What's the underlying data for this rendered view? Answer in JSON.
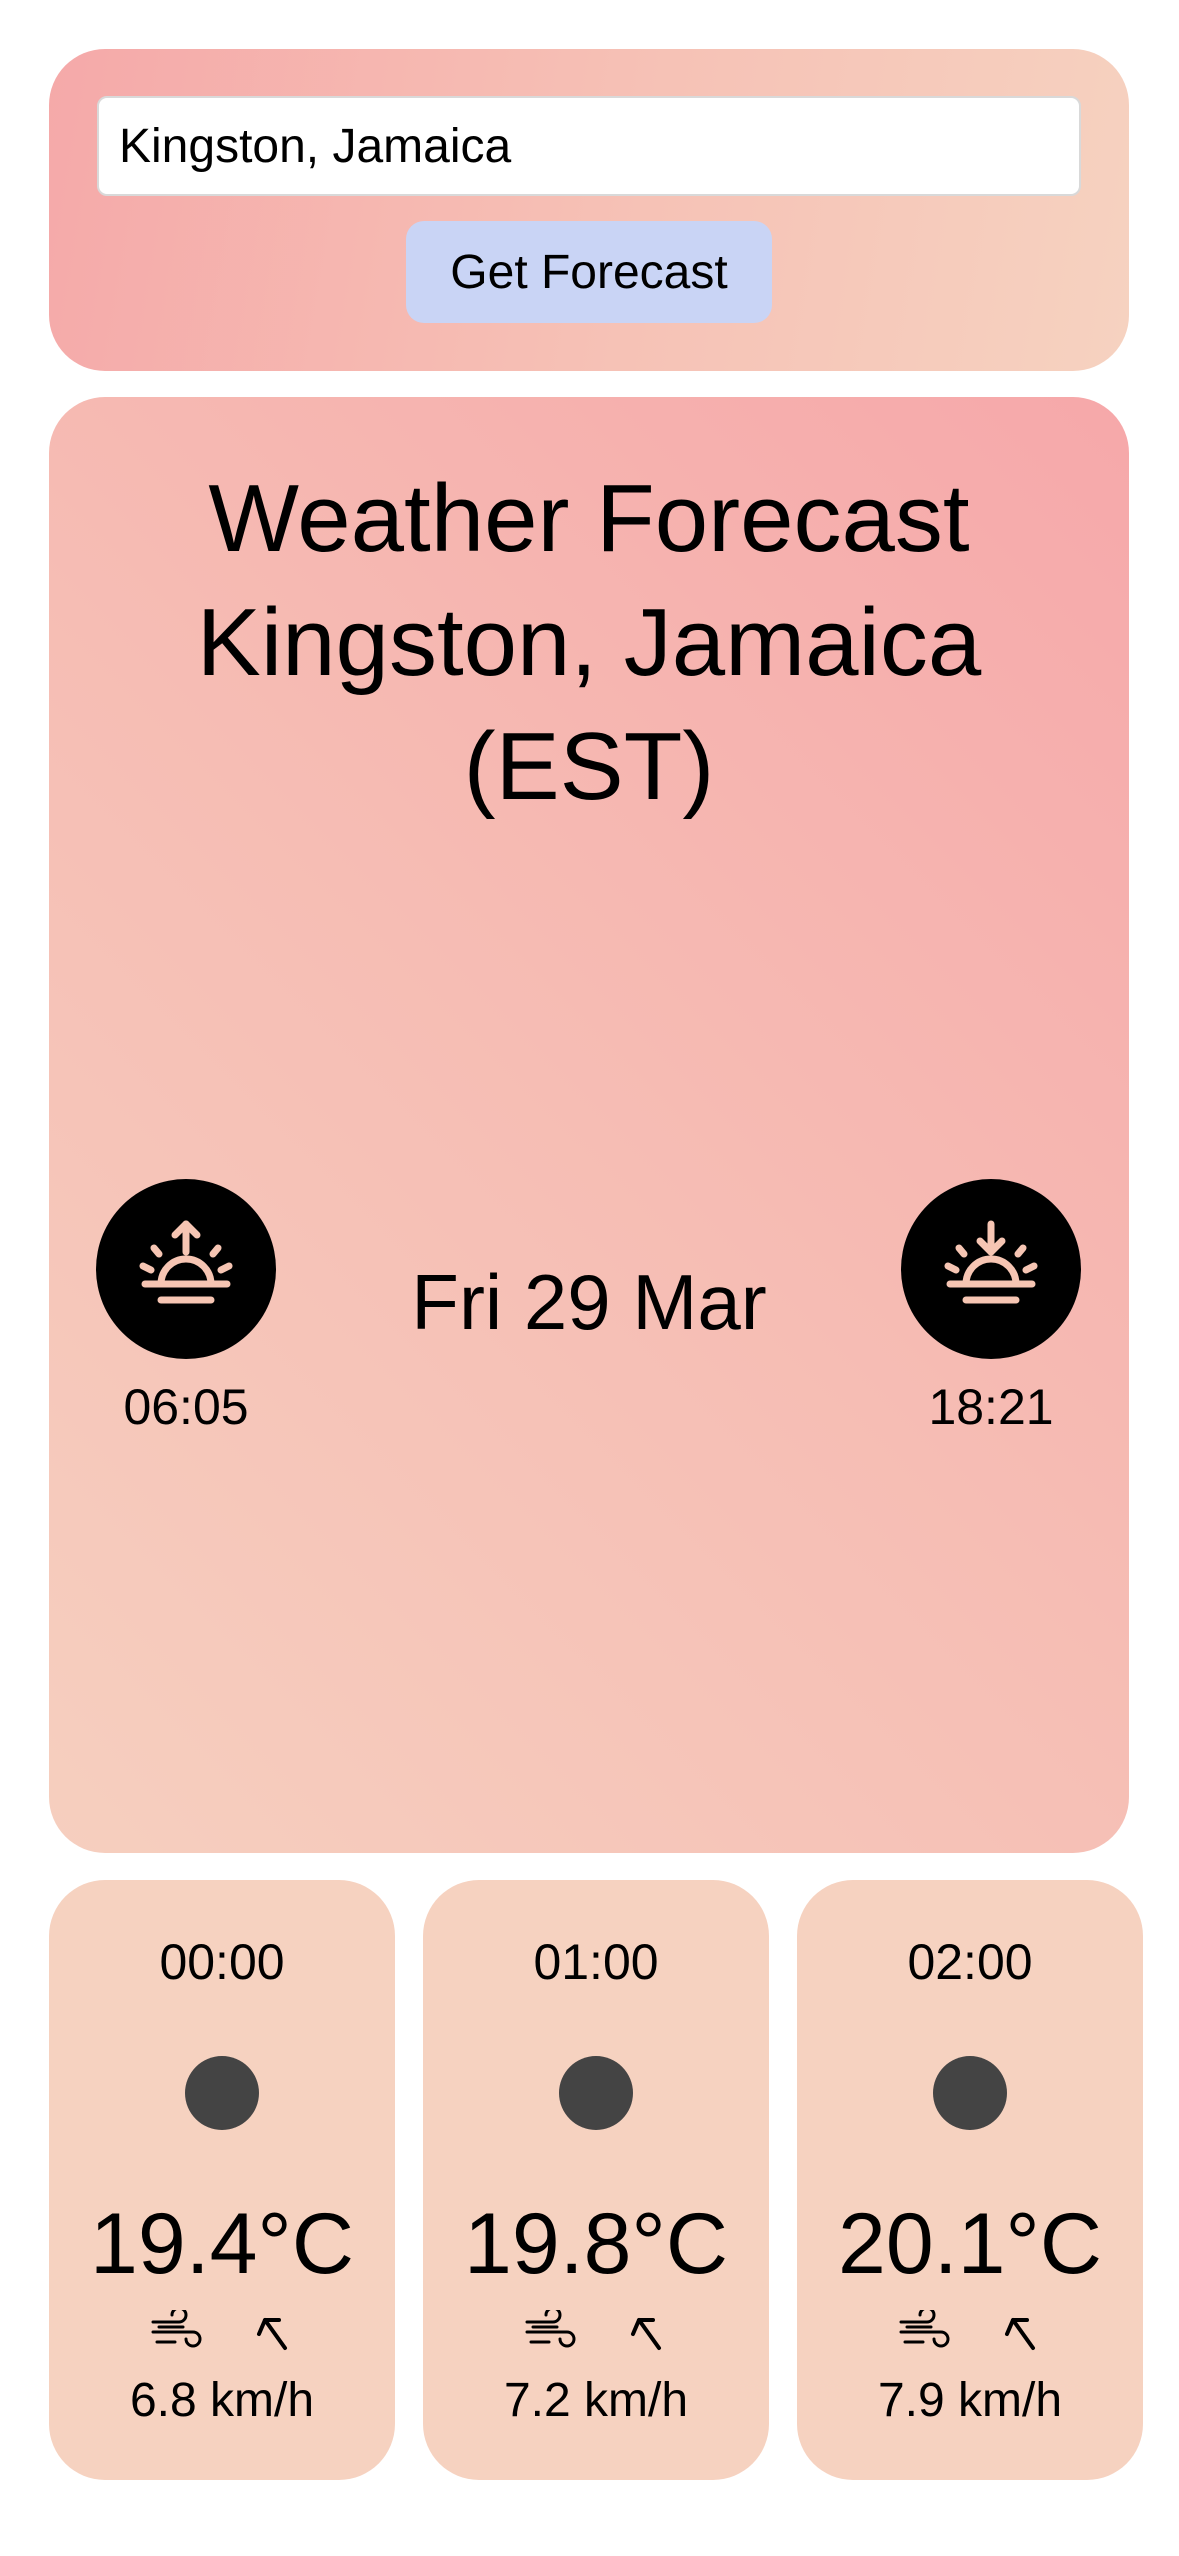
{
  "search": {
    "value": "Kingston, Jamaica",
    "button_label": "Get Forecast"
  },
  "forecast": {
    "title_line1": "Weather Forecast",
    "title_line2": "Kingston, Jamaica",
    "title_line3": "(EST)",
    "date": "Fri 29 Mar",
    "sunrise": {
      "icon": "sunrise-icon",
      "time": "06:05"
    },
    "sunset": {
      "icon": "sunset-icon",
      "time": "18:21"
    }
  },
  "hourly": [
    {
      "time": "00:00",
      "temp": "19.4°C",
      "wind": "6.8 km/h",
      "condition_icon": "clear-night-dot-icon",
      "wind_icon": "wind-icon",
      "direction_icon": "arrow-up-left-icon"
    },
    {
      "time": "01:00",
      "temp": "19.8°C",
      "wind": "7.2 km/h",
      "condition_icon": "clear-night-dot-icon",
      "wind_icon": "wind-icon",
      "direction_icon": "arrow-up-left-icon"
    },
    {
      "time": "02:00",
      "temp": "20.1°C",
      "wind": "7.9 km/h",
      "condition_icon": "clear-night-dot-icon",
      "wind_icon": "wind-icon",
      "direction_icon": "arrow-up-left-icon"
    }
  ],
  "colors": {
    "page_background": "#ffffff",
    "card_pink": "#f6a8aa",
    "card_peach": "#f6d2c0",
    "button_blue": "#c9d4f5",
    "icon_circle": "#000000",
    "icon_glyph": "#f6c5b3",
    "dot_gray": "#444444"
  }
}
